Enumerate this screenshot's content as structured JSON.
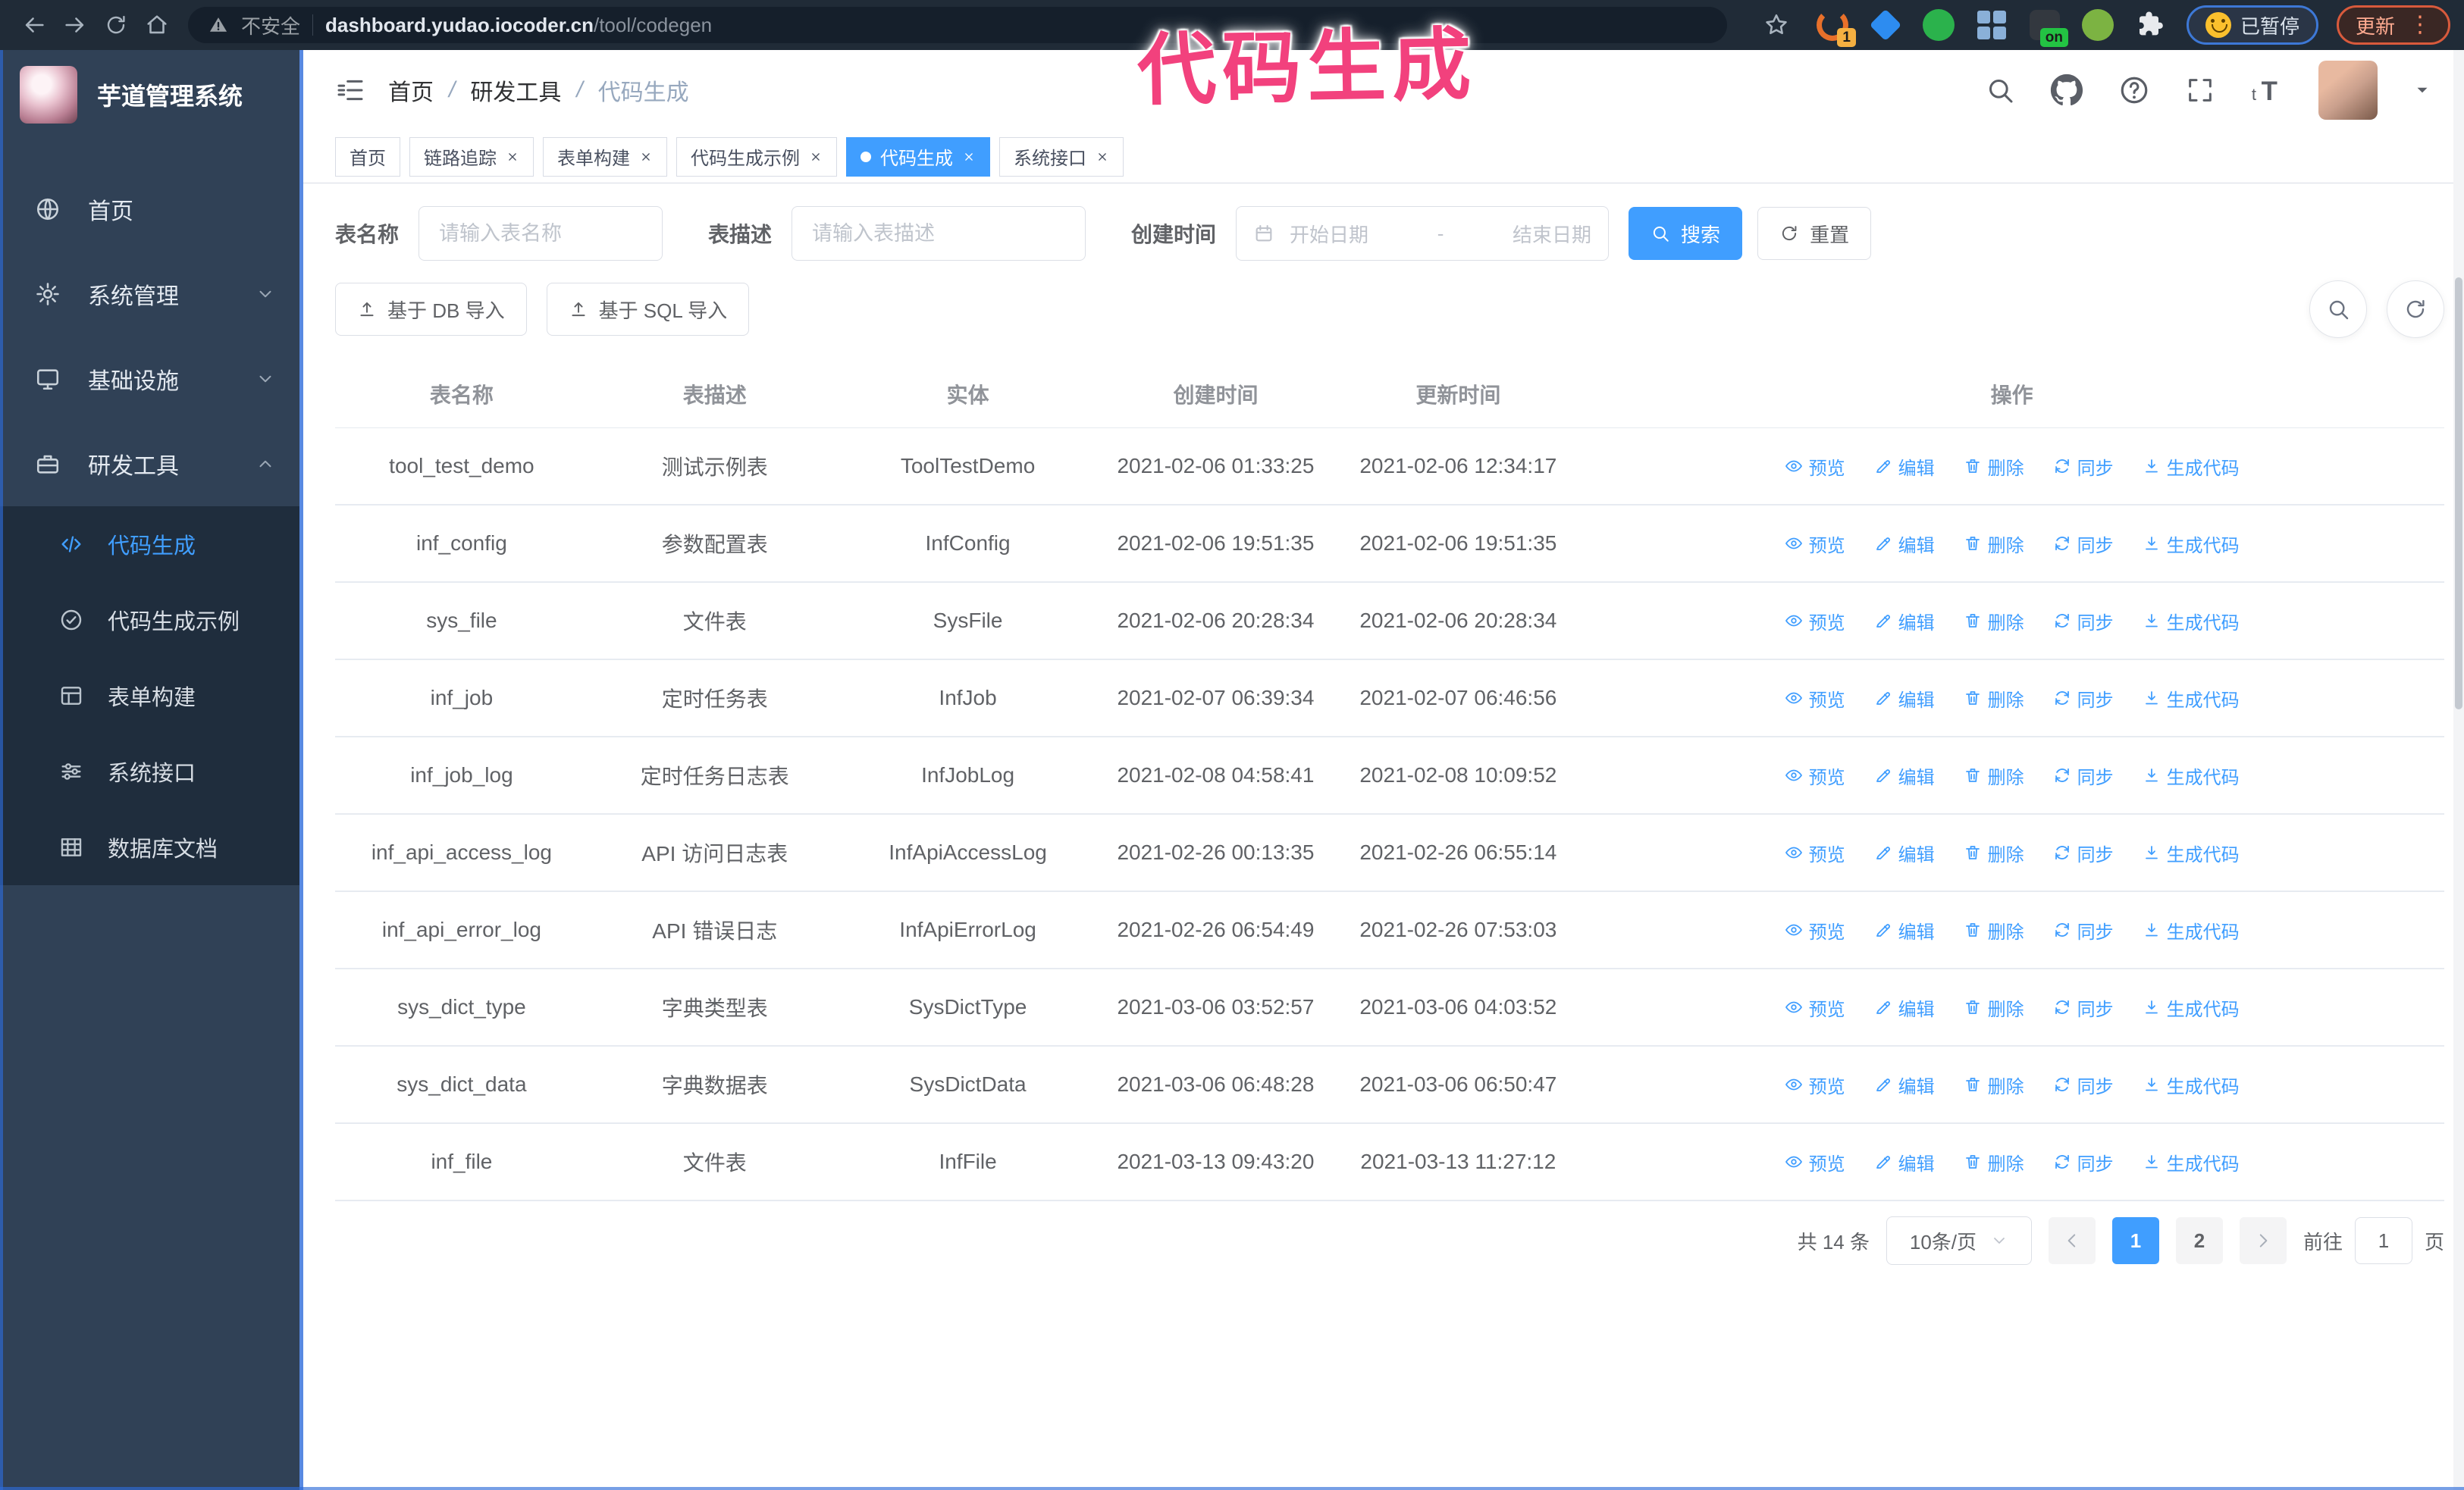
{
  "browser": {
    "security_label": "不安全",
    "url_host": "dashboard.yudao.iocoder.cn",
    "url_path": "/tool/codegen",
    "paused_label": "已暂停",
    "update_label": "更新",
    "extensions": [
      {
        "name": "orange-extension-icon",
        "shape": "swirl",
        "color": "#e8702a",
        "badge": "1",
        "badge_color": "#f5b041"
      },
      {
        "name": "blue-gem-extension-icon",
        "shape": "diamond",
        "color": "#2d8cf0"
      },
      {
        "name": "green-check-extension-icon",
        "shape": "circle",
        "color": "#2bb24c"
      },
      {
        "name": "grid-extension-icon",
        "shape": "grid",
        "color": "#8ab0d8"
      },
      {
        "name": "dark-on-extension-icon",
        "shape": "square",
        "color": "#33383f",
        "badge": "on",
        "badge_color": "#23c343"
      },
      {
        "name": "green-robot-extension-icon",
        "shape": "circle",
        "color": "#7cb342"
      },
      {
        "name": "puzzle-extension-icon",
        "shape": "puzzle",
        "color": "#e8eaed"
      }
    ]
  },
  "annotation": {
    "text": "代码生成",
    "color": "#f2417d"
  },
  "colors": {
    "primary": "#409eff",
    "sidebar_bg": "#304156",
    "submenu_bg": "#1f2d3d"
  },
  "sidebar": {
    "logo_title": "芋道管理系统",
    "items": [
      {
        "label": "首页",
        "icon": "globe-icon"
      },
      {
        "label": "系统管理",
        "icon": "gear-icon",
        "chevron": "down"
      },
      {
        "label": "基础设施",
        "icon": "monitor-icon",
        "chevron": "down"
      },
      {
        "label": "研发工具",
        "icon": "toolbox-icon",
        "chevron": "up"
      }
    ],
    "submenu": [
      {
        "label": "代码生成",
        "icon": "code-icon",
        "active": true
      },
      {
        "label": "代码生成示例",
        "icon": "circle-check-icon"
      },
      {
        "label": "表单构建",
        "icon": "form-icon"
      },
      {
        "label": "系统接口",
        "icon": "sliders-icon"
      },
      {
        "label": "数据库文档",
        "icon": "table-icon"
      }
    ]
  },
  "header": {
    "breadcrumb": [
      "首页",
      "研发工具",
      "代码生成"
    ]
  },
  "tabs": [
    {
      "label": "首页"
    },
    {
      "label": "链路追踪",
      "closable": true
    },
    {
      "label": "表单构建",
      "closable": true
    },
    {
      "label": "代码生成示例",
      "closable": true
    },
    {
      "label": "代码生成",
      "closable": true,
      "active": true
    },
    {
      "label": "系统接口",
      "closable": true
    }
  ],
  "filters": {
    "table_name_label": "表名称",
    "table_name_placeholder": "请输入表名称",
    "table_desc_label": "表描述",
    "table_desc_placeholder": "请输入表描述",
    "create_time_label": "创建时间",
    "date_start_placeholder": "开始日期",
    "date_separator": "-",
    "date_end_placeholder": "结束日期",
    "search_label": "搜索",
    "reset_label": "重置"
  },
  "toolbar": {
    "import_db_label": "基于 DB 导入",
    "import_sql_label": "基于 SQL 导入"
  },
  "table": {
    "columns": [
      "表名称",
      "表描述",
      "实体",
      "创建时间",
      "更新时间",
      "操作"
    ],
    "actions": [
      {
        "label": "预览",
        "icon": "eye-icon"
      },
      {
        "label": "编辑",
        "icon": "edit-icon"
      },
      {
        "label": "删除",
        "icon": "delete-icon"
      },
      {
        "label": "同步",
        "icon": "sync-icon"
      },
      {
        "label": "生成代码",
        "icon": "download-icon"
      }
    ],
    "rows": [
      {
        "name": "tool_test_demo",
        "desc": "测试示例表",
        "entity": "ToolTestDemo",
        "created": "2021-02-06 01:33:25",
        "updated": "2021-02-06 12:34:17"
      },
      {
        "name": "inf_config",
        "desc": "参数配置表",
        "entity": "InfConfig",
        "created": "2021-02-06 19:51:35",
        "updated": "2021-02-06 19:51:35"
      },
      {
        "name": "sys_file",
        "desc": "文件表",
        "entity": "SysFile",
        "created": "2021-02-06 20:28:34",
        "updated": "2021-02-06 20:28:34"
      },
      {
        "name": "inf_job",
        "desc": "定时任务表",
        "entity": "InfJob",
        "created": "2021-02-07 06:39:34",
        "updated": "2021-02-07 06:46:56"
      },
      {
        "name": "inf_job_log",
        "desc": "定时任务日志表",
        "entity": "InfJobLog",
        "created": "2021-02-08 04:58:41",
        "updated": "2021-02-08 10:09:52"
      },
      {
        "name": "inf_api_access_log",
        "desc": "API 访问日志表",
        "entity": "InfApiAccessLog",
        "created": "2021-02-26 00:13:35",
        "updated": "2021-02-26 06:55:14"
      },
      {
        "name": "inf_api_error_log",
        "desc": "API 错误日志",
        "entity": "InfApiErrorLog",
        "created": "2021-02-26 06:54:49",
        "updated": "2021-02-26 07:53:03"
      },
      {
        "name": "sys_dict_type",
        "desc": "字典类型表",
        "entity": "SysDictType",
        "created": "2021-03-06 03:52:57",
        "updated": "2021-03-06 04:03:52"
      },
      {
        "name": "sys_dict_data",
        "desc": "字典数据表",
        "entity": "SysDictData",
        "created": "2021-03-06 06:48:28",
        "updated": "2021-03-06 06:50:47"
      },
      {
        "name": "inf_file",
        "desc": "文件表",
        "entity": "InfFile",
        "created": "2021-03-13 09:43:20",
        "updated": "2021-03-13 11:27:12"
      }
    ]
  },
  "pagination": {
    "total_label": "共 14 条",
    "page_size": "10条/页",
    "pages": [
      {
        "label": "1",
        "active": true
      },
      {
        "label": "2"
      }
    ],
    "goto_label": "前往",
    "goto_value": "1",
    "page_suffix": "页"
  }
}
